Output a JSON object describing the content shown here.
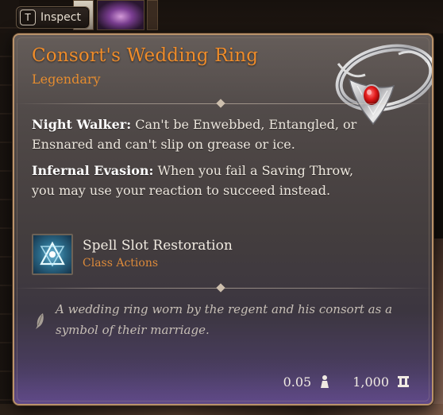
{
  "hotkey": {
    "key": "T",
    "label": "Inspect"
  },
  "item": {
    "name": "Consort's Wedding Ring",
    "rarity": "Legendary",
    "properties": [
      {
        "name": "Night Walker:",
        "text": " Can't be Enwebbed, Entangled, or Ensnared and can't slip on grease or ice."
      },
      {
        "name": "Infernal Evasion:",
        "text_before": " When you fail a ",
        "highlight": "Saving Throw",
        "text_after": ", you may use your reaction to succeed instead."
      }
    ],
    "action": {
      "name": "Spell Slot Restoration",
      "type": "Class Actions",
      "icon": "spell-slot-restoration-icon"
    },
    "lore": "A wedding ring worn by the regent and his consort as a symbol of their marriage.",
    "weight": "0.05",
    "price": "1,000"
  },
  "colors": {
    "title": "#ef8c2a",
    "rarity": "#e58c2f",
    "border": "#b9926a",
    "gem": "#e01818"
  }
}
